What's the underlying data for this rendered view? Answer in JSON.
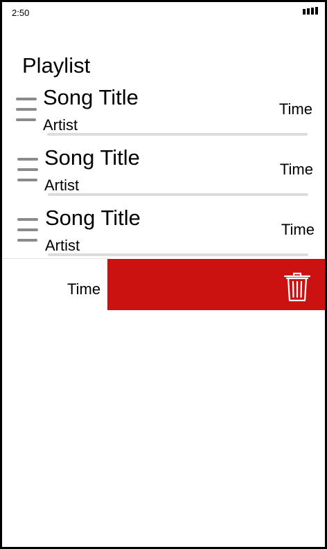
{
  "status_bar": {
    "time": "2:50",
    "signal_icon": "signal-bars-icon"
  },
  "playlist": {
    "title": "Playlist",
    "songs": [
      {
        "title": "Song Title",
        "artist": "Artist",
        "time": "Time"
      },
      {
        "title": "Song Title",
        "artist": "Artist",
        "time": "Time"
      },
      {
        "title": "Song Title",
        "artist": "Artist",
        "time": "Time"
      }
    ],
    "swiped_row": {
      "time": "Time",
      "action_icon": "trash-icon"
    }
  },
  "colors": {
    "delete_background": "#cc1111",
    "handle": "#8a8a8a",
    "divider": "#dcdcdc"
  }
}
